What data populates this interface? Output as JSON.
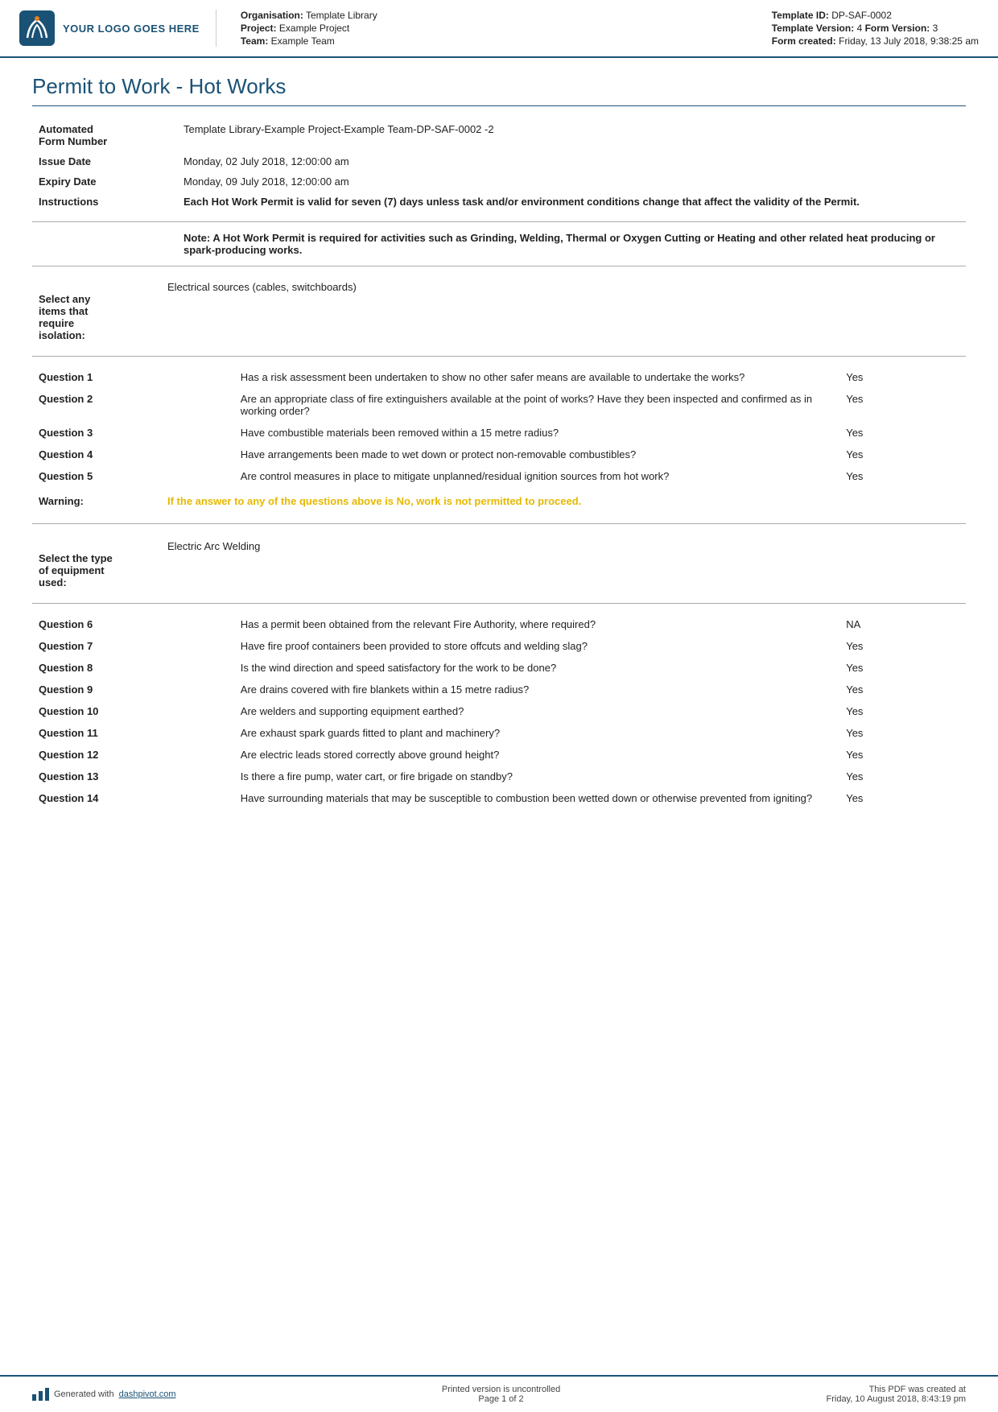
{
  "header": {
    "logo_alt": "YOUR LOGO GOES HERE",
    "organisation_label": "Organisation:",
    "organisation_value": "Template Library",
    "project_label": "Project:",
    "project_value": "Example Project",
    "team_label": "Team:",
    "team_value": "Example Team",
    "template_id_label": "Template ID:",
    "template_id_value": "DP-SAF-0002",
    "template_version_label": "Template Version:",
    "template_version_value": "4",
    "form_version_label": "Form Version:",
    "form_version_value": "3",
    "form_created_label": "Form created:",
    "form_created_value": "Friday, 13 July 2018, 9:38:25 am"
  },
  "document": {
    "title": "Permit to Work - Hot Works"
  },
  "info": {
    "automated_label": "Automated\nForm Number",
    "automated_value": "Template Library-Example Project-Example Team-DP-SAF-0002  -2",
    "issue_date_label": "Issue Date",
    "issue_date_value": "Monday, 02 July 2018, 12:00:00 am",
    "expiry_date_label": "Expiry Date",
    "expiry_date_value": "Monday, 09 July 2018, 12:00:00 am",
    "instructions_label": "Instructions",
    "instructions_value": "Each Hot Work Permit is valid for seven (7) days unless task and/or environment conditions change that affect the validity of the Permit."
  },
  "note": "Note: A Hot Work Permit is required for activities such as Grinding, Welding, Thermal or Oxygen Cutting or Heating and other related heat producing or spark-producing works.",
  "isolation": {
    "label": "Select any\nitems that\nrequire\nisolation:",
    "value": "Electrical sources (cables, switchboards)"
  },
  "questions": [
    {
      "id": "Question 1",
      "text": "Has a risk assessment been undertaken to show no other safer means are available to undertake the works?",
      "answer": "Yes"
    },
    {
      "id": "Question 2",
      "text": "Are an appropriate class of fire extinguishers available at the point of works? Have they been inspected and confirmed as in working order?",
      "answer": "Yes"
    },
    {
      "id": "Question 3",
      "text": "Have combustible materials been removed within a 15 metre radius?",
      "answer": "Yes"
    },
    {
      "id": "Question 4",
      "text": "Have arrangements been made to wet down or protect non-removable combustibles?",
      "answer": "Yes"
    },
    {
      "id": "Question 5",
      "text": "Are control measures in place to mitigate unplanned/residual ignition sources from hot work?",
      "answer": "Yes"
    }
  ],
  "warning": {
    "label": "Warning:",
    "text": "If the answer to any of the questions above is No, work is not permitted to proceed."
  },
  "equipment": {
    "label": "Select the type\nof equipment\nused:",
    "value": "Electric Arc Welding"
  },
  "questions2": [
    {
      "id": "Question 6",
      "text": "Has a permit been obtained from the relevant Fire Authority, where required?",
      "answer": "NA"
    },
    {
      "id": "Question 7",
      "text": "Have fire proof containers been provided to store offcuts and welding slag?",
      "answer": "Yes"
    },
    {
      "id": "Question 8",
      "text": "Is the wind direction and speed satisfactory for the work to be done?",
      "answer": "Yes"
    },
    {
      "id": "Question 9",
      "text": "Are drains covered with fire blankets within a 15 metre radius?",
      "answer": "Yes"
    },
    {
      "id": "Question 10",
      "text": "Are welders and supporting equipment earthed?",
      "answer": "Yes"
    },
    {
      "id": "Question 11",
      "text": "Are exhaust spark guards fitted to plant and machinery?",
      "answer": "Yes"
    },
    {
      "id": "Question 12",
      "text": "Are electric leads stored correctly above ground height?",
      "answer": "Yes"
    },
    {
      "id": "Question 13",
      "text": "Is there a fire pump, water cart, or fire brigade on standby?",
      "answer": "Yes"
    },
    {
      "id": "Question 14",
      "text": "Have surrounding materials that may be susceptible to combustion been wetted down or otherwise prevented from igniting?",
      "answer": "Yes"
    }
  ],
  "footer": {
    "generated_text": "Generated with",
    "dashpivot_link": "dashpivot.com",
    "center_text": "Printed version is uncontrolled",
    "page_text": "Page 1 of 2",
    "right_text": "This PDF was created at",
    "right_date": "Friday, 10 August 2018, 8:43:19 pm"
  }
}
